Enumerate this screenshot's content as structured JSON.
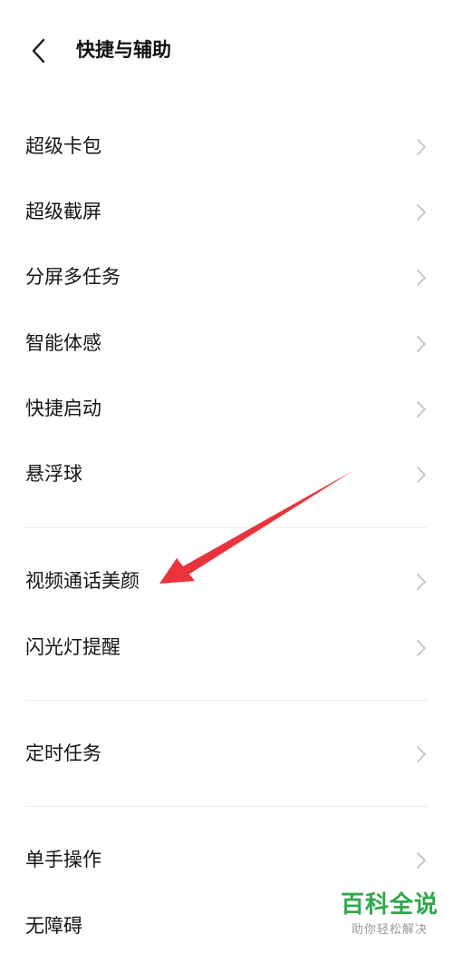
{
  "header": {
    "title": "快捷与辅助",
    "back_icon": "chevron-left-icon"
  },
  "sections": [
    {
      "items": [
        {
          "label": "超级卡包"
        },
        {
          "label": "超级截屏"
        },
        {
          "label": "分屏多任务"
        },
        {
          "label": "智能体感"
        },
        {
          "label": "快捷启动"
        },
        {
          "label": "悬浮球"
        }
      ]
    },
    {
      "items": [
        {
          "label": "视频通话美颜"
        },
        {
          "label": "闪光灯提醒"
        }
      ]
    },
    {
      "items": [
        {
          "label": "定时任务"
        }
      ]
    },
    {
      "items": [
        {
          "label": "单手操作"
        },
        {
          "label": "无障碍"
        }
      ]
    }
  ],
  "row_icon": "chevron-right-icon",
  "annotation": {
    "icon": "red-arrow-annotation",
    "color": "#e8343a"
  },
  "watermark": {
    "title": "百科全说",
    "subtitle": "助你轻松解决"
  },
  "colors": {
    "background": "#ffffff",
    "text": "#151515",
    "chevron": "#c4c4c4",
    "divider": "#ececec",
    "watermark_green": "#2fa84a"
  }
}
